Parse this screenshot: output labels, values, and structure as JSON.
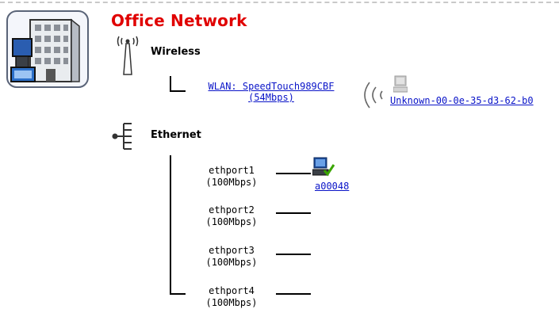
{
  "title": "Office Network",
  "wireless": {
    "label": "Wireless",
    "icon": "antenna-icon",
    "wlan": {
      "line1": "WLAN: SpeedTouch989CBF",
      "line2": "(54Mbps)"
    },
    "client": {
      "name": "Unknown-00-0e-35-d3-62-b0",
      "icon": "computer-icon"
    }
  },
  "ethernet": {
    "label": "Ethernet",
    "icon": "ethernet-hub-icon",
    "ports": [
      {
        "name": "ethport1",
        "speed": "(100Mbps)",
        "device": "a00048"
      },
      {
        "name": "ethport2",
        "speed": "(100Mbps)"
      },
      {
        "name": "ethport3",
        "speed": "(100Mbps)"
      },
      {
        "name": "ethport4",
        "speed": "(100Mbps)"
      }
    ]
  },
  "colors": {
    "title": "#e00000",
    "link": "#0a14c8",
    "device_ok": "#3aa500"
  }
}
